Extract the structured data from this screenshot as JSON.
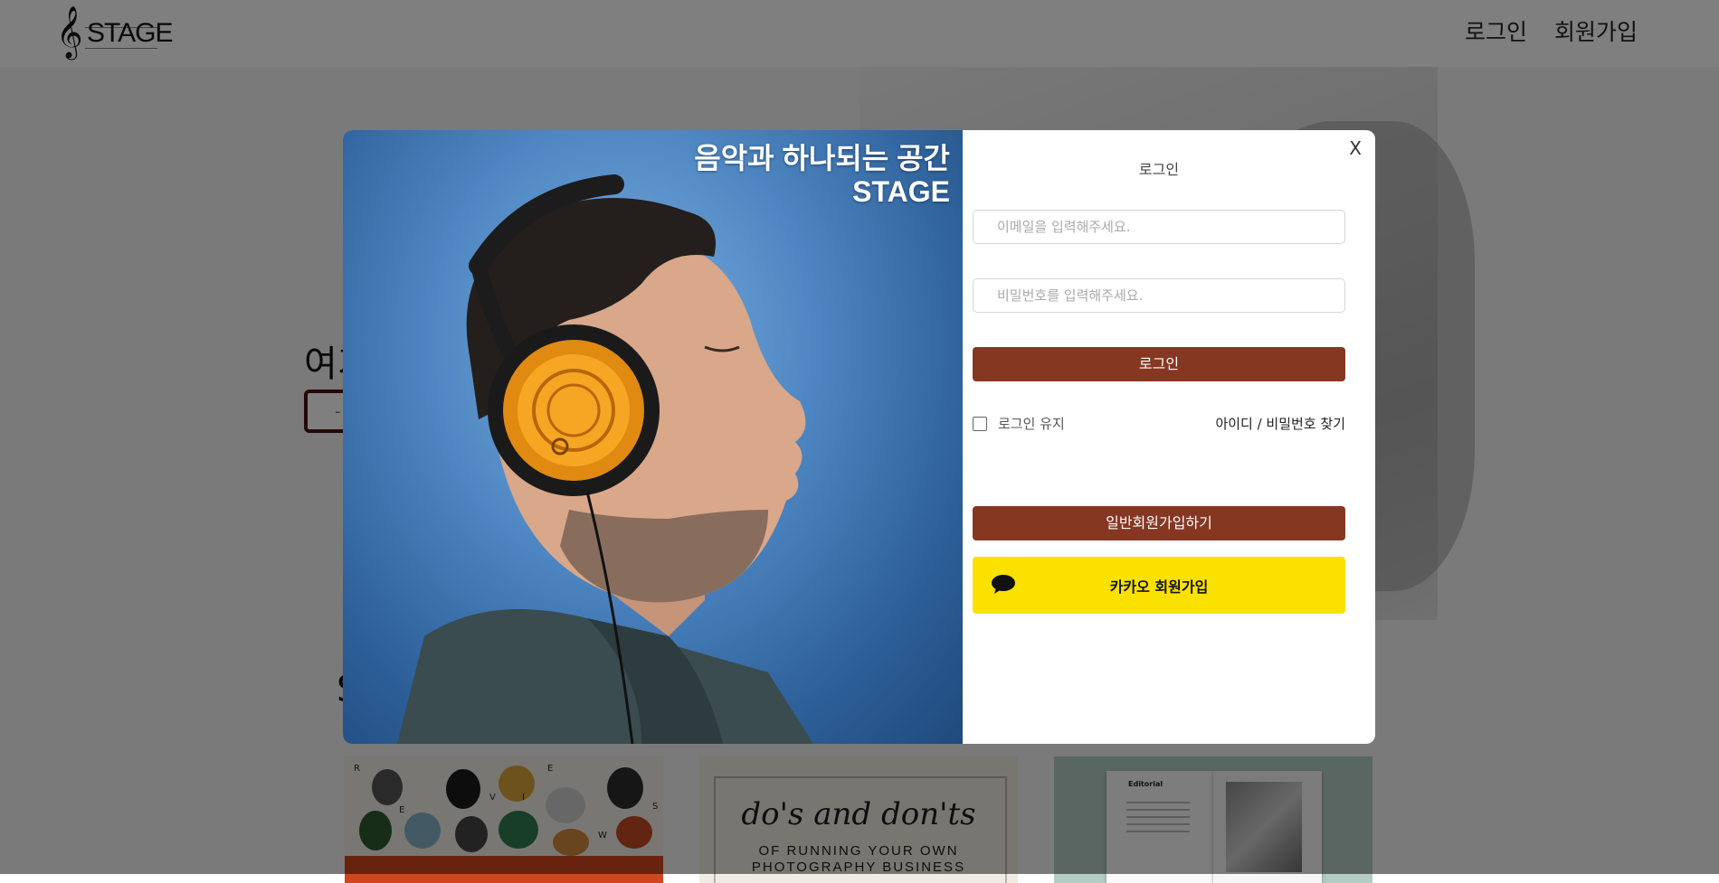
{
  "header": {
    "logo_text": "STAGE",
    "nav": {
      "login": "로그인",
      "signup": "회원가입"
    }
  },
  "hero": {
    "title_partial": "여기",
    "button_partial": "-"
  },
  "section": {
    "title_partial": "S"
  },
  "cards": {
    "card1": {
      "letters": [
        "R",
        "E",
        "V",
        "I",
        "E",
        "S",
        "W",
        "S"
      ]
    },
    "card2": {
      "script": "do's and don'ts",
      "line1": "OF RUNNING YOUR OWN",
      "line2": "PHOTOGRAPHY BUSINESS"
    },
    "card3": {
      "heading": "Editorial"
    }
  },
  "modal": {
    "image": {
      "headline_line1": "음악과 하나되는 공간",
      "headline_line2": "STAGE"
    },
    "close": "X",
    "title": "로그인",
    "email_placeholder": "이메일을 입력해주세요.",
    "password_placeholder": "비밀번호를 입력해주세요.",
    "login_button": "로그인",
    "keep_login": "로그인 유지",
    "find_account": "아이디 / 비밀번호 찾기",
    "signup_button": "일반회원가입하기",
    "kakao_button": "카카오 회원가입"
  },
  "colors": {
    "brand_brown": "#863722",
    "kakao_yellow": "#fae100",
    "overlay": "rgba(0,0,0,0.5)"
  },
  "icons": {
    "kakao": "speech-bubble-icon",
    "logo": "treble-clef-logo"
  }
}
